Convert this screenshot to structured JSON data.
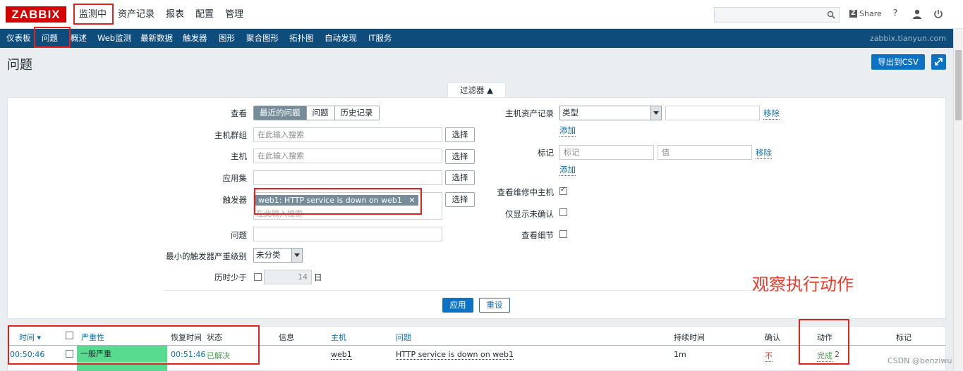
{
  "header": {
    "logo": "ZABBIX",
    "menu": [
      "监测中",
      "资产记录",
      "报表",
      "配置",
      "管理"
    ],
    "share_label": "Share",
    "help_icon": "?",
    "server_name": "zabbix.tianyun.com"
  },
  "subnav": [
    "仪表板",
    "问题",
    "概述",
    "Web监测",
    "最新数据",
    "触发器",
    "图形",
    "聚合图形",
    "拓扑图",
    "自动发现",
    "IT服务"
  ],
  "page": {
    "title": "问题",
    "export_csv": "导出到CSV"
  },
  "filter": {
    "tab_label": "过滤器 ▲",
    "show_label": "查看",
    "show_options": [
      "最近的问题",
      "问题",
      "历史记录"
    ],
    "host_group_label": "主机群组",
    "host_label": "主机",
    "application_label": "应用集",
    "trigger_label": "触发器",
    "problem_label": "问题",
    "min_severity_label": "最小的触发器严重级别",
    "age_label": "历时少于",
    "placeholder": "在此输入搜索",
    "select_btn": "选择",
    "trigger_chip": "web1: HTTP service is down on web1",
    "severity_value": "未分类",
    "age_value": "14",
    "age_unit": "日",
    "inventory_label": "主机资产记录",
    "inventory_type": "类型",
    "remove": "移除",
    "add": "添加",
    "tags_label": "标记",
    "tag_placeholder": "标记",
    "value_placeholder": "值",
    "maintenance_label": "查看维修中主机",
    "unack_label": "仅显示未确认",
    "details_label": "查看细节",
    "apply": "应用",
    "reset": "重设"
  },
  "table": {
    "headers": {
      "time": "时间 ▾",
      "severity": "严重性",
      "recovery_time": "恢复时间",
      "status": "状态",
      "info": "信息",
      "host": "主机",
      "problem": "问题",
      "duration": "持续时间",
      "ack": "确认",
      "actions": "动作",
      "tags": "标记"
    },
    "rows": [
      {
        "time": "00:50:46",
        "severity": "一般严重",
        "recovery_time": "00:51:46",
        "status": "已解决",
        "host": "web1",
        "problem": "HTTP service is down on web1",
        "duration": "1m",
        "ack": "不",
        "actions": "完成",
        "actions_count": "2"
      }
    ]
  },
  "annotation": "观察执行动作",
  "watermark": "CSDN @benziwu",
  "colors": {
    "brand": "#d40000",
    "nav": "#0e4c7c",
    "button": "#0e72c4",
    "severity_average": "#59db8f",
    "resolved": "#429e47",
    "annotation_red": "#e0241d"
  }
}
